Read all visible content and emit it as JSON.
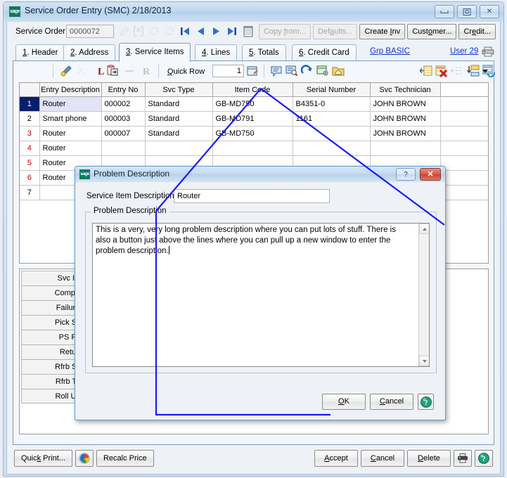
{
  "window": {
    "title": "Service Order Entry (SMC) 2/18/2013",
    "logo_text": "sage",
    "buttons": {
      "minimize": "minimize-button",
      "restore": "restore-button",
      "close": "close-button"
    }
  },
  "header": {
    "service_order_label": "Service Order",
    "service_order_value": "0000072",
    "nav": {
      "first": "first-record",
      "prev": "previous-record",
      "next": "next-record",
      "last": "last-record",
      "memo": "memo"
    },
    "action_buttons": [
      {
        "label": "Copy from...",
        "name": "copy-from-button",
        "disabled": true
      },
      {
        "label": "Defaults...",
        "name": "defaults-button",
        "disabled": true
      },
      {
        "label": "Create Inv",
        "name": "create-inv-button",
        "disabled": false
      },
      {
        "label": "Customer...",
        "name": "customer-button",
        "disabled": false
      },
      {
        "label": "Credit...",
        "name": "credit-button",
        "disabled": false
      }
    ]
  },
  "tabs": [
    {
      "label": "1. Header",
      "active": false
    },
    {
      "label": "2. Address",
      "active": false
    },
    {
      "label": "3. Service Items",
      "active": true
    },
    {
      "label": "4. Lines",
      "active": false
    },
    {
      "label": "5. Totals",
      "active": false
    },
    {
      "label": "6. Credit Card",
      "active": false
    }
  ],
  "tab_links": [
    {
      "label": "Grp BASIC",
      "name": "grp-basic-link"
    },
    {
      "label": "User 29",
      "name": "user-29-link"
    }
  ],
  "grid_toolbar": {
    "quick_row_label": "Quick Row",
    "quick_row_value": "1",
    "icons_left": [
      "pencil-highlight-icon",
      "erase-icon",
      "bold-l-icon",
      "clipboard-paste-icon",
      "minus-icon",
      "bold-r-icon"
    ],
    "icons_mid": [
      "comment-icon",
      "comment-search-icon",
      "refresh-arrow-icon",
      "export-window-icon",
      "folder-home-icon"
    ],
    "icons_right": [
      "insert-row-icon",
      "delete-row-icon",
      "indent-row-icon",
      "fill-down-icon",
      "row-settings-icon",
      "dropdown-caret-icon"
    ]
  },
  "grid": {
    "columns": [
      "",
      "Entry Description",
      "Entry No",
      "Svc Type",
      "Item Code",
      "Serial Number",
      "Svc Technician",
      ""
    ],
    "rows": [
      {
        "no": "1",
        "entry_description": "Router",
        "entry_no": "000002",
        "svc_type": "Standard",
        "item_code": "GB-MD750",
        "serial_number": "B4351-0",
        "svc_technician": "JOHN BROWN",
        "selected": true
      },
      {
        "no": "2",
        "entry_description": "Smart phone",
        "entry_no": "000003",
        "svc_type": "Standard",
        "item_code": "GB-MD791",
        "serial_number": "1161",
        "svc_technician": "JOHN BROWN",
        "selected": false
      },
      {
        "no": "3",
        "entry_description": "Router",
        "entry_no": "000007",
        "svc_type": "Standard",
        "item_code": "GB-MD750",
        "serial_number": "",
        "svc_technician": "JOHN BROWN",
        "selected": false
      },
      {
        "no": "4",
        "entry_description": "Router",
        "entry_no": "",
        "svc_type": "",
        "item_code": "",
        "serial_number": "",
        "svc_technician": "",
        "selected": false
      },
      {
        "no": "5",
        "entry_description": "Router",
        "entry_no": "",
        "svc_type": "",
        "item_code": "",
        "serial_number": "",
        "svc_technician": "",
        "selected": false
      },
      {
        "no": "6",
        "entry_description": "Router",
        "entry_no": "",
        "svc_type": "",
        "item_code": "",
        "serial_number": "",
        "svc_technician": "",
        "selected": false
      },
      {
        "no": "7",
        "entry_description": "",
        "entry_no": "",
        "svc_type": "",
        "item_code": "",
        "serial_number": "",
        "svc_technician": "",
        "selected": false
      }
    ]
  },
  "field_list": [
    "Svc Item Desc",
    "Complaint Code",
    "Failure Reason",
    "Pick Sht Printed",
    "PS Print Date",
    "Return Whse",
    "Rfrb Srce Whse",
    "Rfrb Targ Whse",
    "Roll Up Rfrb Co"
  ],
  "bottom_bar": {
    "left": [
      {
        "label": "Quick Print...",
        "name": "quick-print-button"
      },
      {
        "label": "",
        "name": "windows-logo-button"
      },
      {
        "label": "Recalc Price",
        "name": "recalc-price-button"
      }
    ],
    "right": [
      {
        "label": "Accept",
        "name": "accept-button"
      },
      {
        "label": "Cancel",
        "name": "cancel-button"
      },
      {
        "label": "Delete",
        "name": "delete-button"
      },
      {
        "label": "",
        "name": "print-button"
      },
      {
        "label": "",
        "name": "help-button"
      }
    ]
  },
  "dialog": {
    "logo_text": "sage",
    "title": "Problem Description",
    "help_glyph": "?",
    "close_glyph": "✕",
    "service_item_label": "Service Item Description",
    "service_item_value": "Router",
    "group_caption": "Problem Description",
    "textarea_value": "This is a very, very long problem description where you can put lots of stuff. There is also a button just above the lines where you can pull up a new window to enter the problem description.",
    "buttons": [
      {
        "label": "OK",
        "name": "dialog-ok-button"
      },
      {
        "label": "Cancel",
        "name": "dialog-cancel-button"
      }
    ],
    "help_button_name": "dialog-help-button"
  },
  "colors": {
    "callout": "#1a1aff",
    "title_bar": "#c2d7ee",
    "selected_row": "#0a1f6b",
    "link": "#1035bf",
    "close_red": "#c8432f",
    "sage_green": "#0e7a5f"
  }
}
